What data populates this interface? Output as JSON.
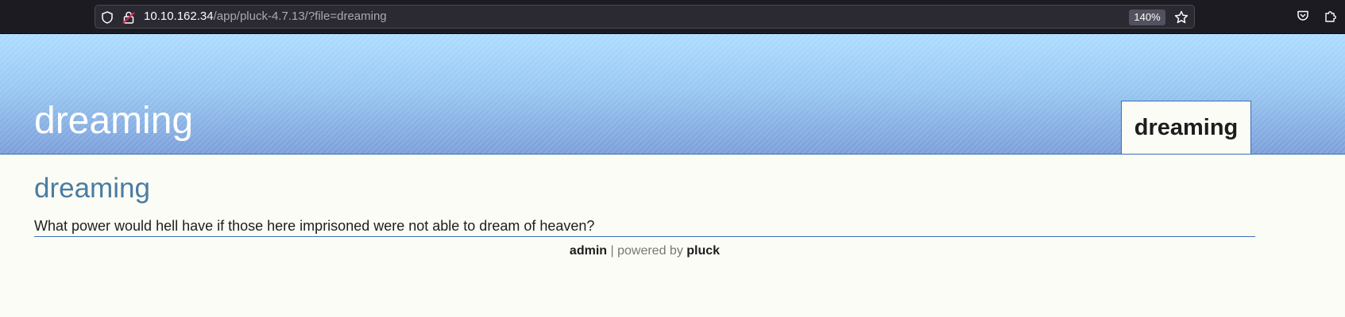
{
  "browser": {
    "url_host": "10.10.162.34",
    "url_path": "/app/pluck-4.7.13/?file=dreaming",
    "zoom": "140%"
  },
  "site": {
    "title": "dreaming",
    "nav_tab": "dreaming"
  },
  "page": {
    "heading": "dreaming",
    "text": "What power would hell have if those here imprisoned were not able to dream of heaven?"
  },
  "footer": {
    "admin_link": "admin",
    "separator": " | powered by ",
    "pluck_link": "pluck"
  }
}
